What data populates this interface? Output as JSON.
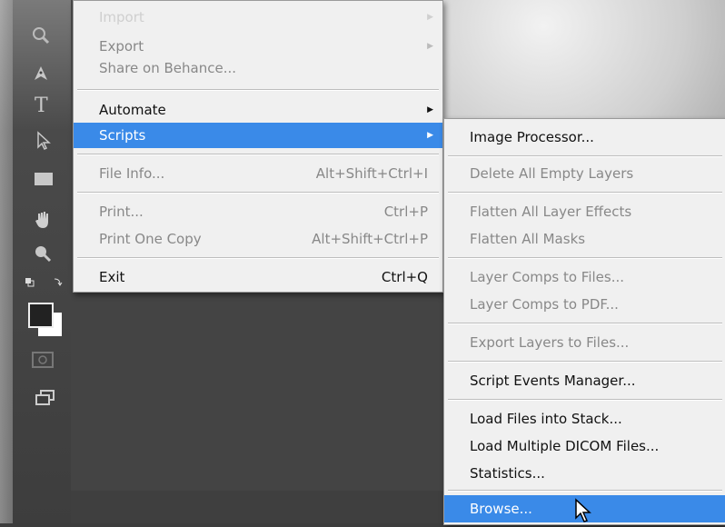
{
  "file_menu": {
    "items": [
      {
        "label": "Import",
        "state": "faded"
      },
      {
        "label": "Export",
        "state": "disabled"
      },
      {
        "label": "Share on Behance...",
        "state": "disabled"
      },
      {
        "label": "Automate"
      },
      {
        "label": "Scripts",
        "state": "selected"
      },
      {
        "label": "File Info...",
        "shortcut": "Alt+Shift+Ctrl+I",
        "state": "disabled"
      },
      {
        "label": "Print...",
        "shortcut": "Ctrl+P",
        "state": "disabled"
      },
      {
        "label": "Print One Copy",
        "shortcut": "Alt+Shift+Ctrl+P",
        "state": "disabled"
      },
      {
        "label": "Exit",
        "shortcut": "Ctrl+Q"
      }
    ]
  },
  "scripts_menu": {
    "items": [
      {
        "label": "Image Processor..."
      },
      {
        "label": "Delete All Empty Layers",
        "state": "disabled"
      },
      {
        "label": "Flatten All Layer Effects",
        "state": "disabled"
      },
      {
        "label": "Flatten All Masks",
        "state": "disabled"
      },
      {
        "label": "Layer Comps to Files...",
        "state": "disabled"
      },
      {
        "label": "Layer Comps to PDF...",
        "state": "disabled"
      },
      {
        "label": "Export Layers to Files...",
        "state": "disabled"
      },
      {
        "label": "Script Events Manager..."
      },
      {
        "label": "Load Files into Stack..."
      },
      {
        "label": "Load Multiple DICOM Files..."
      },
      {
        "label": "Statistics..."
      },
      {
        "label": "Browse...",
        "state": "selected"
      }
    ]
  },
  "colors": {
    "menu_bg": "#f0f0f0",
    "highlight": "#3a8ae8",
    "disabled_text": "#888888"
  },
  "icons": [
    "magnify-icon",
    "pen-icon",
    "type-icon",
    "path-select-icon",
    "rectangle-icon",
    "hand-icon",
    "zoom-icon",
    "swap-colors-icon",
    "color-swatches-icon",
    "quick-mask-icon",
    "screen-mode-icon",
    "cursor-arrow-icon"
  ]
}
